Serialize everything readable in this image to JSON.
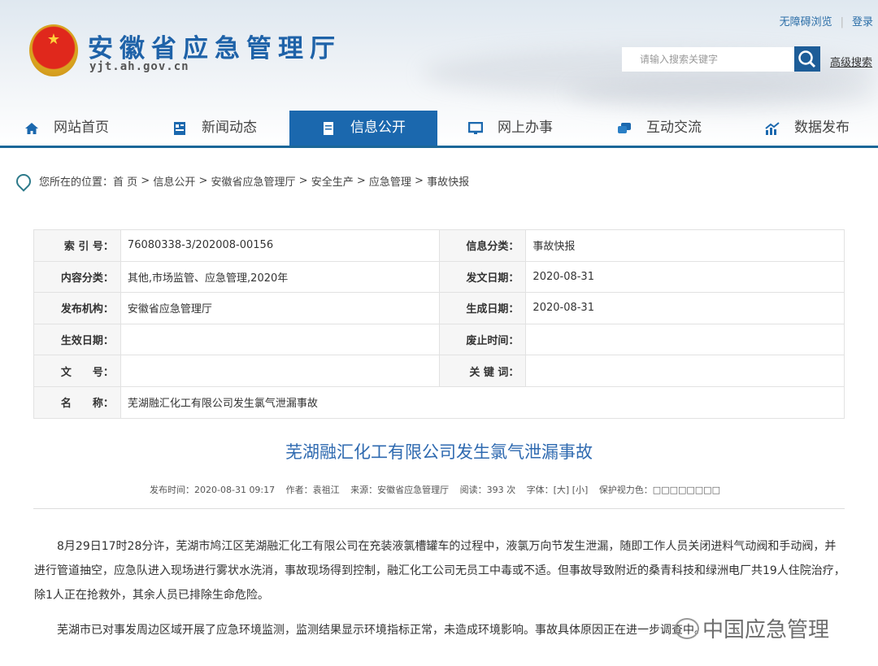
{
  "header": {
    "site_title": "安徽省应急管理厅",
    "domain": "yjt.ah.gov.cn",
    "accessibility": "无障碍浏览",
    "login": "登录",
    "search_placeholder": "请输入搜索关键字",
    "advanced_search": "高级搜索"
  },
  "nav": [
    {
      "label": "网站首页",
      "icon": "home-icon"
    },
    {
      "label": "新闻动态",
      "icon": "news-icon"
    },
    {
      "label": "信息公开",
      "icon": "document-icon",
      "active": true
    },
    {
      "label": "网上办事",
      "icon": "monitor-icon"
    },
    {
      "label": "互动交流",
      "icon": "chat-icon"
    },
    {
      "label": "数据发布",
      "icon": "chart-icon"
    }
  ],
  "breadcrumb": {
    "prefix": "您所在的位置：",
    "items": [
      "首 页",
      "信息公开",
      "安徽省应急管理厅",
      "安全生产",
      "应急管理",
      "事故快报"
    ]
  },
  "meta": {
    "index_label": "索 引 号：",
    "index": "76080338-3/202008-00156",
    "category_label": "信息分类：",
    "category": "事故快报",
    "content_label": "内容分类：",
    "content": "其他,市场监管、应急管理,2020年",
    "issue_date_label": "发文日期：",
    "issue_date": "2020-08-31",
    "publisher_label": "发布机构：",
    "publisher": "安徽省应急管理厅",
    "gen_date_label": "生成日期：",
    "gen_date": "2020-08-31",
    "effective_label": "生效日期：",
    "effective": "",
    "abolish_label": "废止时间：",
    "abolish": "",
    "docno_label": "文　　号：",
    "docno": "",
    "keywords_label": "关 键 词：",
    "keywords": "",
    "name_label": "名　　称：",
    "name": "芜湖融汇化工有限公司发生氯气泄漏事故"
  },
  "article": {
    "title": "芜湖融汇化工有限公司发生氯气泄漏事故",
    "published": "发布时间：2020-08-31 09:17",
    "author": "作者：袁祖江",
    "source": "来源：安徽省应急管理厅",
    "reads": "阅读：393 次",
    "font": "字体：[大] [小]",
    "eye_color": "保护视力色：□□□□□□□□",
    "paragraphs": [
      "8月29日17时28分许，芜湖市鸠江区芜湖融汇化工有限公司在充装液氯槽罐车的过程中，液氯万向节发生泄漏，随即工作人员关闭进料气动阀和手动阀，并进行管道抽空，应急队进入现场进行雾状水洗消，事故现场得到控制，融汇化工公司无员工中毒或不适。但事故导致附近的桑青科技和绿洲电厂共19人住院治疗，除1人正在抢救外，其余人员已排除生命危险。",
      "芜湖市已对事发周边区域开展了应急环境监测，监测结果显示环境指标正常，未造成环境影响。事故具体原因正在进一步调查中。"
    ]
  },
  "watermark": "中国应急管理"
}
